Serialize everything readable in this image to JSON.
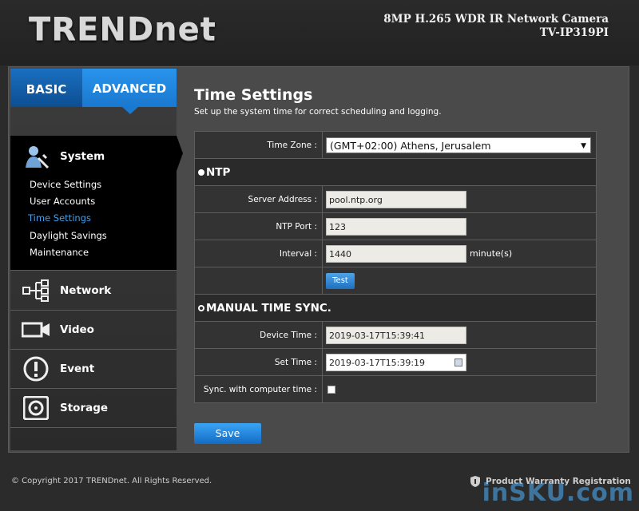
{
  "header": {
    "logo": "TRENDnet",
    "model_line1": "8MP H.265 WDR IR Network Camera",
    "model_line2": "TV-IP319PI"
  },
  "tabs": {
    "basic": "BASIC",
    "advanced": "ADVANCED"
  },
  "sidebar": {
    "system": "System",
    "sub_items": [
      "Device Settings",
      "User Accounts",
      "Time Settings",
      "Daylight Savings",
      "Maintenance"
    ],
    "active_sub": "Time Settings",
    "network": "Network",
    "video": "Video",
    "event": "Event",
    "storage": "Storage"
  },
  "page": {
    "title": "Time Settings",
    "subtitle": "Set up the system time for correct scheduling and logging."
  },
  "form": {
    "time_zone_label": "Time Zone :",
    "time_zone_value": "(GMT+02:00) Athens, Jerusalem",
    "ntp_header": "NTP",
    "server_label": "Server Address :",
    "server_value": "pool.ntp.org",
    "port_label": "NTP Port :",
    "port_value": "123",
    "interval_label": "Interval :",
    "interval_value": "1440",
    "interval_unit": "minute(s)",
    "test_button": "Test",
    "manual_header": "MANUAL TIME SYNC.",
    "device_time_label": "Device Time :",
    "device_time_value": "2019-03-17T15:39:41",
    "set_time_label": "Set Time :",
    "set_time_value": "2019-03-17T15:39:19",
    "sync_label": "Sync. with computer time :"
  },
  "save_button": "Save",
  "footer": {
    "copyright": "© Copyright 2017 TRENDnet. All Rights Reserved.",
    "warranty": "Product Warranty Registration",
    "watermark": "inSKU.com"
  },
  "colors": {
    "accent": "#1a78cf",
    "active_link": "#3ea0f0"
  }
}
